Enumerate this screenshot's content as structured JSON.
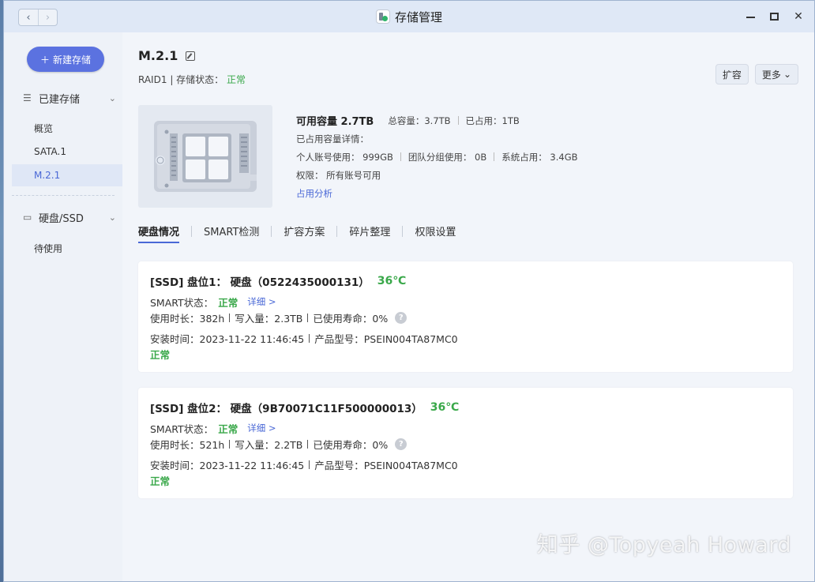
{
  "titlebar": {
    "title": "存储管理",
    "back_label": "‹",
    "forward_label": "›"
  },
  "sidebar": {
    "new_button": "新建存储",
    "sections": [
      {
        "label": "已建存储",
        "items": [
          "概览",
          "SATA.1",
          "M.2.1"
        ],
        "active": "M.2.1"
      },
      {
        "label": "硬盘/SSD",
        "items": [
          "待使用"
        ]
      }
    ]
  },
  "volume": {
    "name": "M.2.1",
    "raid": "RAID1",
    "status_label": "存储状态：",
    "status_value": "正常",
    "expand_button": "扩容",
    "more_button": "更多"
  },
  "capacity": {
    "available": "可用容量 2.7TB",
    "total": "总容量：3.7TB",
    "used": "已占用：1TB",
    "used_detail_title": "已占用容量详情：",
    "personal": "个人账号使用： 999GB",
    "team": "团队分组使用： 0B",
    "system": "系统占用： 3.4GB",
    "permission": "权限： 所有账号可用",
    "analysis_link": "占用分析"
  },
  "tabs": [
    "硬盘情况",
    "SMART检测",
    "扩容方案",
    "碎片整理",
    "权限设置"
  ],
  "disks": [
    {
      "header": "[SSD] 盘位1：  硬盘（0522435000131）",
      "temp": "36℃",
      "smart_label": "SMART状态：",
      "smart_value": "正常",
      "detail_link": "详细 >",
      "uptime": "使用时长：382h",
      "written": "写入量：2.3TB",
      "life": "已使用寿命：0%",
      "install": "安装时间：2023-11-22 11:46:45",
      "model": "产品型号：PSEIN004TA87MC0",
      "state": "正常"
    },
    {
      "header": "[SSD] 盘位2：  硬盘（9B70071C11F500000013）",
      "temp": "36℃",
      "smart_label": "SMART状态：",
      "smart_value": "正常",
      "detail_link": "详细 >",
      "uptime": "使用时长：521h",
      "written": "写入量：2.2TB",
      "life": "已使用寿命：0%",
      "install": "安装时间：2023-11-22 11:46:45",
      "model": "产品型号：PSEIN004TA87MC0",
      "state": "正常"
    }
  ],
  "watermark": "知乎 @Topyeah Howard",
  "colors": {
    "accent": "#5b72e0",
    "ok": "#3aa84a",
    "link": "#4a68d6"
  }
}
